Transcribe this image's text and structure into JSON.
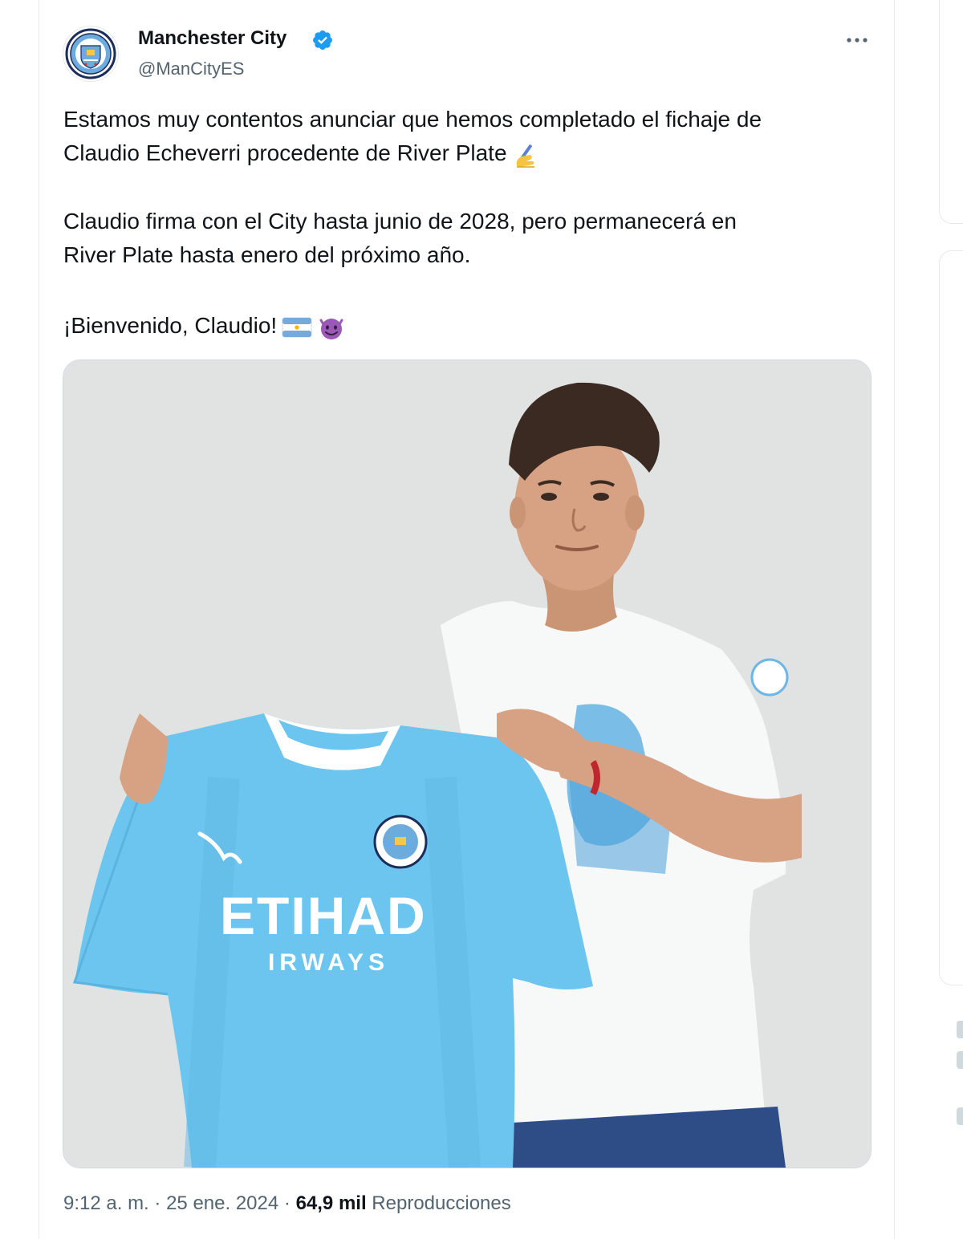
{
  "author": {
    "name": "Manchester City",
    "handle": "@ManCityES",
    "avatar_icon": "man-city-crest-icon",
    "verified_icon": "verified-badge-icon"
  },
  "menu": {
    "icon": "more-options-icon"
  },
  "tweet": {
    "paragraph1_line1": "Estamos muy contentos anunciar que hemos completado el fichaje de",
    "paragraph1_line2": "Claudio Echeverri procedente de River Plate",
    "paragraph1_emoji": "writing-hand-emoji",
    "paragraph2_line1": "Claudio firma con el City hasta junio de 2028, pero permanecerá en",
    "paragraph2_line2": "River Plate hasta enero del próximo año.",
    "paragraph3": "¡Bienvenido, Claudio!",
    "paragraph3_emojis": [
      "argentina-flag-emoji",
      "smiling-devil-emoji"
    ]
  },
  "media": {
    "jersey_sponsor_line1": "ETIHAD",
    "jersey_sponsor_line2": "IRWAYS",
    "jersey_color": "#6cc5ee",
    "background_color": "#e3e5e4"
  },
  "footer": {
    "time": "9:12 a. m.",
    "separator": "·",
    "date": "25 ene. 2024",
    "views_count": "64,9 mil",
    "views_label": "Reproducciones"
  },
  "colors": {
    "verified": "#1d9bf0",
    "secondary_text": "#536471",
    "primary_text": "#0f1419",
    "border": "#e7e9ea"
  }
}
